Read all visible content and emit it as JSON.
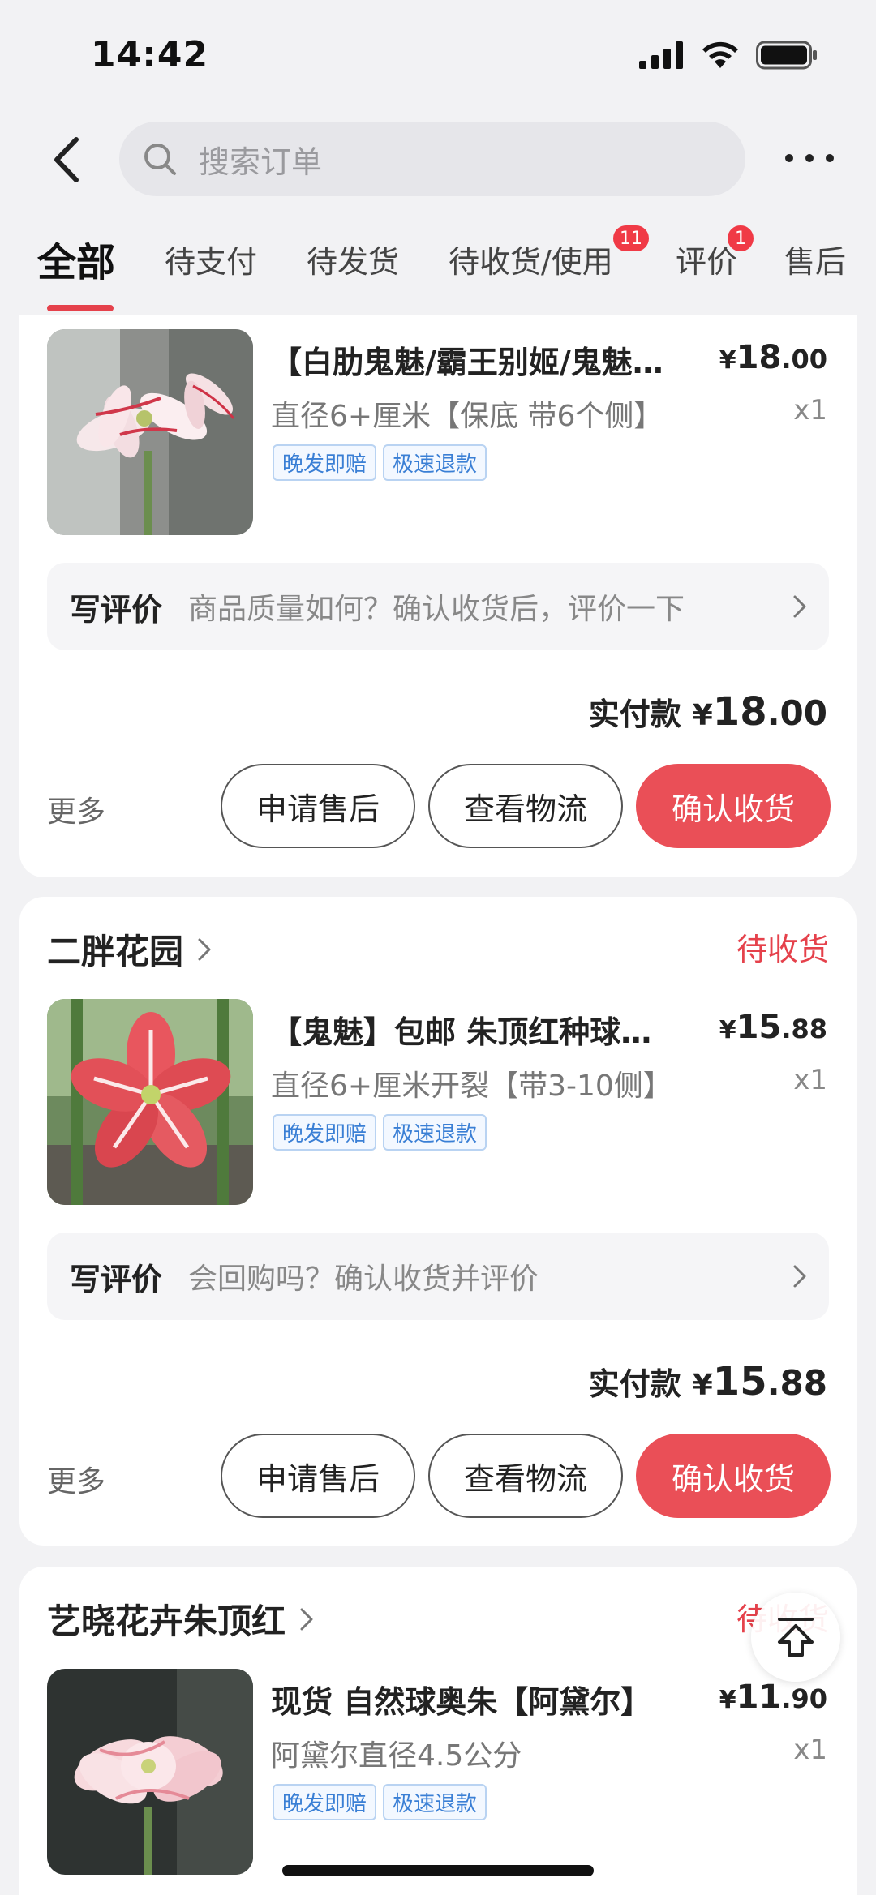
{
  "status_bar": {
    "time": "14:42"
  },
  "search": {
    "placeholder": "搜索订单"
  },
  "tabs": [
    {
      "label": "全部",
      "active": true
    },
    {
      "label": "待支付"
    },
    {
      "label": "待发货"
    },
    {
      "label": "待收货/使用",
      "badge": "11"
    },
    {
      "label": "评价",
      "badge": "1"
    },
    {
      "label": "售后"
    }
  ],
  "orders": [
    {
      "product": {
        "title": "【白肋鬼魅/霸王别姬/鬼魅…",
        "price_currency": "¥",
        "price_int": "18",
        "price_dec": ".00",
        "spec": "直径6+厘米【保底 带6个侧】",
        "qty": "x1",
        "tags": [
          "晚发即赔",
          "极速退款"
        ]
      },
      "review": {
        "label": "写评价",
        "prompt": "商品质量如何？确认收货后，评价一下"
      },
      "paid": {
        "label": "实付款",
        "currency": "¥",
        "int": "18",
        "dec": ".00"
      },
      "actions": {
        "more": "更多",
        "after_sale": "申请售后",
        "logistics": "查看物流",
        "confirm": "确认收货"
      }
    },
    {
      "shop": "二胖花园",
      "status": "待收货",
      "product": {
        "title": "【鬼魅】包邮 朱顶红种球…",
        "price_currency": "¥",
        "price_int": "15",
        "price_dec": ".88",
        "spec": "直径6+厘米开裂【带3-10侧】",
        "qty": "x1",
        "tags": [
          "晚发即赔",
          "极速退款"
        ]
      },
      "review": {
        "label": "写评价",
        "prompt": "会回购吗？确认收货并评价"
      },
      "paid": {
        "label": "实付款",
        "currency": "¥",
        "int": "15",
        "dec": ".88"
      },
      "actions": {
        "more": "更多",
        "after_sale": "申请售后",
        "logistics": "查看物流",
        "confirm": "确认收货"
      }
    },
    {
      "shop": "艺晓花卉朱顶红",
      "status": "待收货",
      "product": {
        "title": "现货 自然球奥朱【阿黛尔】",
        "price_currency": "¥",
        "price_int": "11",
        "price_dec": ".90",
        "spec": "阿黛尔直径4.5公分",
        "qty": "x1",
        "tags": [
          "晚发即赔",
          "极速退款"
        ]
      }
    }
  ],
  "colors": {
    "accent": "#e5414b",
    "button_primary": "#ea4f57",
    "tag_blue": "#3a7fd5"
  },
  "icons": [
    "back-arrow-icon",
    "search-icon",
    "more-dots-icon",
    "chevron-right-icon",
    "back-to-top-icon",
    "signal-icon",
    "wifi-icon",
    "battery-icon"
  ]
}
